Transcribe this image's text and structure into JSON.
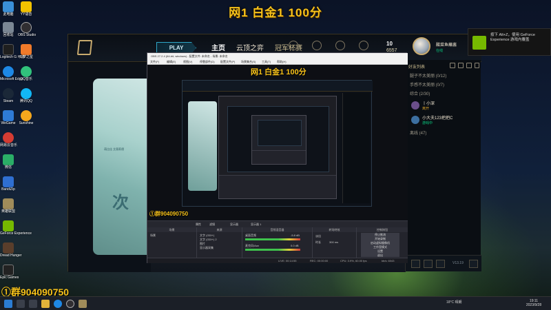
{
  "stream": {
    "title": "网1 白金1 100分",
    "qq_group": "①群904090750"
  },
  "desktop": {
    "icons": [
      {
        "label": "此电脑",
        "color": "#3a8fd8"
      },
      {
        "label": "回收站",
        "color": "#7b8794"
      },
      {
        "label": "Logitech G HUB",
        "color": "#1f1f1f"
      },
      {
        "label": "Microsoft Edge",
        "color": "#1e88e5"
      },
      {
        "label": "Steam",
        "color": "#1b2838"
      },
      {
        "label": "WeGame",
        "color": "#2e7bd6"
      },
      {
        "label": "网易云音乐",
        "color": "#d43c33"
      },
      {
        "label": "微信",
        "color": "#2aae67"
      },
      {
        "label": "BandiZip",
        "color": "#2f6fd1"
      },
      {
        "label": "英雄联盟",
        "color": "#a08c5a"
      },
      {
        "label": "GeForce Experience",
        "color": "#76b900"
      },
      {
        "label": "Dread Hunger",
        "color": "#5a3e2b"
      },
      {
        "label": "Epic Games",
        "color": "#222222"
      },
      {
        "label": "YY语音",
        "color": "#f2c200"
      },
      {
        "label": "OBS Studio",
        "color": "#302e31"
      },
      {
        "label": "元梦之星",
        "color": "#f07a2a"
      },
      {
        "label": "QQ音乐",
        "color": "#31c27c"
      },
      {
        "label": "腾讯QQ",
        "color": "#12b7f5"
      },
      {
        "label": "Sunshine",
        "color": "#f4a71d"
      }
    ]
  },
  "lol": {
    "play_label": "PLAY",
    "nav": {
      "home": "主页",
      "tft": "云顶之弈",
      "clash": "冠军杯赛"
    },
    "top_icons": [
      "商城",
      "战利品",
      "收藏",
      "个人资料"
    ],
    "rp": "10",
    "be": "6557",
    "summoner": "酸菜鱼蘸酱",
    "summoner_status": "在线",
    "splash_text": "次",
    "splash_small": "萌比佳 艾薇莉德",
    "friends": {
      "header": "好友列表",
      "groups": [
        {
          "label": "腿子不太美丽 (0/12)"
        },
        {
          "label": "手感不太美丽 (0/7)"
        },
        {
          "label": "综合 (2/30)"
        },
        {
          "label": "离线 (47)"
        }
      ],
      "online": [
        {
          "name": "丨小深",
          "sub": "离开",
          "sub_color": "#d9a12a",
          "avatar": "#6b4f8a"
        },
        {
          "name": "小大夫123把把C",
          "sub": "游戏中",
          "sub_color": "#0acf83",
          "avatar": "#3c6fa0"
        }
      ],
      "version": "V13.19"
    }
  },
  "nvidia": {
    "text": "按下 Alt+Z，使用 GeForce Experience 游戏内覆盖"
  },
  "obs": {
    "title": "OBS 27.2.4 (64-bit, windows) - 配置文件: 未命名 - 场景: 未命名",
    "menu": [
      "文件(F)",
      "编辑(E)",
      "视图(V)",
      "停靠部件(D)",
      "配置文件(P)",
      "场景集合(S)",
      "工具(T)",
      "帮助(H)"
    ],
    "toolbar": [
      "属性",
      "滤镜",
      "显示器",
      "显示器 1"
    ],
    "docks": {
      "scenes": {
        "title": "场景",
        "items": [
          "场景"
        ]
      },
      "sources": {
        "title": "来源",
        "items": [
          "文字 (GDI+)",
          "文字 (GDI+) 2",
          "图片",
          "显示器采集"
        ]
      },
      "mixer": {
        "title": "音频混音器",
        "tracks": [
          {
            "name": "桌面音频",
            "db": "-5.8 dB"
          },
          {
            "name": "麦克风/Aux",
            "db": "0.0 dB"
          }
        ]
      },
      "transitions": {
        "title": "转场特效",
        "type": "淡出",
        "duration_label": "时长",
        "duration": "300 ms"
      },
      "controls": {
        "title": "控制按钮",
        "buttons": [
          "停止推流",
          "开始录制",
          "启动虚拟摄像机",
          "工作室模式",
          "设置",
          "退出"
        ]
      }
    },
    "status": {
      "live": "LIVE: 00:14:55",
      "rec": "REC: 00:00:00",
      "cpu": "CPU: 3.9%, 60.00 fps",
      "kbps": "kb/s: 6043"
    }
  },
  "taskbar": {
    "temperature": "18°C 晴朗",
    "time": "19:11",
    "date": "2023/9/28"
  }
}
